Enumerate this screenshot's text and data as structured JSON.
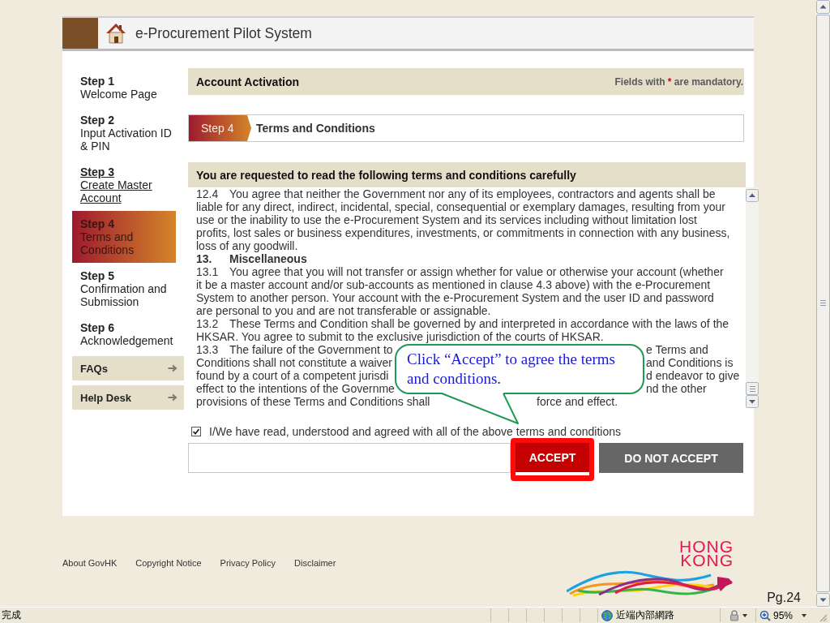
{
  "header": {
    "title": "e-Procurement Pilot System"
  },
  "steps": [
    {
      "step": "Step 1",
      "label": "Welcome Page",
      "selected": false,
      "link": false
    },
    {
      "step": "Step 2",
      "label": "Input Activation ID & PIN",
      "selected": false,
      "link": false
    },
    {
      "step": "Step 3",
      "label": "Create Master Account",
      "selected": false,
      "link": true
    },
    {
      "step": "Step 4",
      "label": "Terms and Conditions",
      "selected": true,
      "link": false
    },
    {
      "step": "Step 5",
      "label": "Confirmation and Submission",
      "selected": false,
      "link": false
    },
    {
      "step": "Step 6",
      "label": "Acknowledgement",
      "selected": false,
      "link": false
    }
  ],
  "side_links": [
    {
      "label": "FAQs"
    },
    {
      "label": "Help Desk"
    }
  ],
  "page_bar": {
    "title": "Account Activation",
    "note": {
      "before": "Fields with",
      "mark": "*",
      "after": "are mandatory."
    }
  },
  "step_bar": {
    "tab": "Step 4",
    "title": "Terms and Conditions"
  },
  "terms": {
    "heading": "You are requested to read the following terms and conditions carefully",
    "lines": [
      {
        "kind": "text",
        "num": "12.4",
        "text": "You agree that neither the Government nor any of its employees, contractors and agents shall be"
      },
      {
        "kind": "text",
        "text": "liable for any direct, indirect, incidental, special, consequential or exemplary damages, resulting from your"
      },
      {
        "kind": "text",
        "text": "use or the inability to use the e-Procurement System and its services including without limitation lost"
      },
      {
        "kind": "text",
        "text": "profits, lost sales or business expenditures, investments, or commitments in connection with any business,"
      },
      {
        "kind": "text",
        "text": "loss of any goodwill."
      },
      {
        "kind": "heading",
        "num": "13.",
        "text": "Miscellaneous"
      },
      {
        "kind": "text",
        "num": "13.1",
        "text": "You agree that you will not transfer or assign whether for value or otherwise your account (whether"
      },
      {
        "kind": "text",
        "text": "it be a master account and/or sub-accounts as mentioned in clause 4.3 above) with the e-Procurement"
      },
      {
        "kind": "text",
        "text": "System to another person. Your account with the e-Procurement System and the user ID and password"
      },
      {
        "kind": "text",
        "text": "are personal to you and are not transferable or assignable."
      },
      {
        "kind": "text",
        "num": "13.2",
        "text": "These Terms and Condition shall be governed by and interpreted in accordance with the laws of the"
      },
      {
        "kind": "text",
        "text": "HKSAR. You agree to submit to the exclusive jurisdiction of the courts of HKSAR."
      },
      {
        "kind": "covered",
        "num": "13.3",
        "text": "The failure of the Government to",
        "rest": "e Terms and"
      },
      {
        "kind": "covered",
        "text": "Conditions shall not constitute a waiver",
        "rest": "and Conditions is"
      },
      {
        "kind": "covered",
        "text": "found by a court of a competent jurisdi",
        "rest": "d endeavor to give"
      },
      {
        "kind": "covered",
        "text": "effect to the intentions of the Governme",
        "rest": "nd the other"
      },
      {
        "kind": "pointer",
        "text": "provisions of these Terms and Conditions shall",
        "rest": "force and effect."
      }
    ]
  },
  "agreement": {
    "label": "I/We have read, understood and agreed with all of the above terms and conditions",
    "checked": true
  },
  "buttons": [
    {
      "label": "ACCEPT",
      "kind": "primary",
      "highlighted": true
    },
    {
      "label": "DO NOT ACCEPT",
      "kind": "secondary",
      "highlighted": false
    }
  ],
  "callout": {
    "text": "Click “Accept” to agree the terms and conditions."
  },
  "footer": {
    "links": [
      "About GovHK",
      "Copyright Notice",
      "Privacy Policy",
      "Disclaimer"
    ],
    "logo": [
      "HONG",
      "KONG"
    ]
  },
  "page_number": "Pg.24",
  "status_bar": {
    "status": "完成",
    "zone": "近端內部網路",
    "zoom": "95%"
  }
}
